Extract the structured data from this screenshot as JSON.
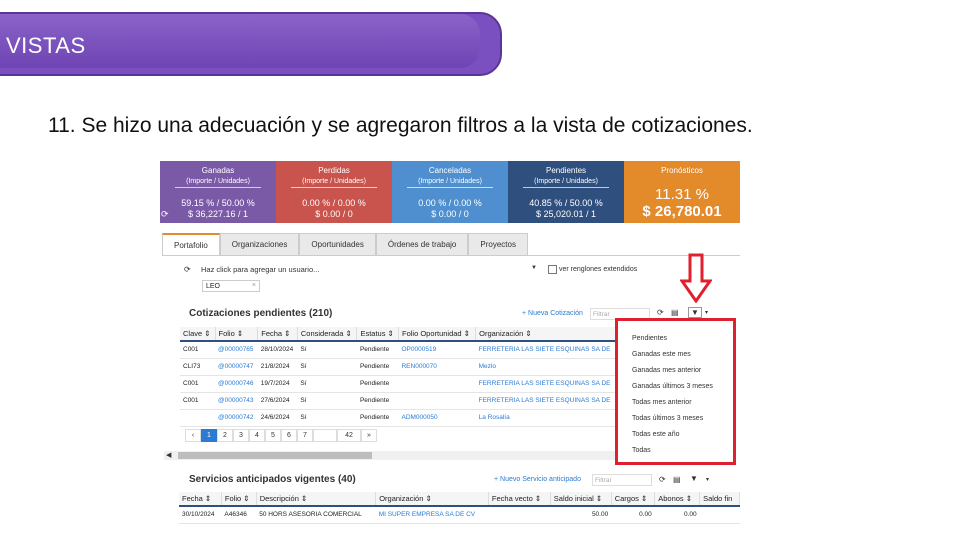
{
  "slide": {
    "title": "VISTAS",
    "text": "11. Se hizo una adecuación y se agregaron filtros a la vista de cotizaciones."
  },
  "colors": {
    "accent": "#7a4fbf",
    "highlight": "#e0202e",
    "link": "#2b7bd3"
  },
  "kpis": [
    {
      "title": "Ganadas",
      "sub": "(Importe / Unidades)",
      "v1": "59.15 % / 50.00 %",
      "v2": "$ 36,227.16 / 1"
    },
    {
      "title": "Perdidas",
      "sub": "(Importe / Unidades)",
      "v1": "0.00 % / 0.00 %",
      "v2": "$ 0.00 / 0"
    },
    {
      "title": "Canceladas",
      "sub": "(Importe / Unidades)",
      "v1": "0.00 % / 0.00 %",
      "v2": "$ 0.00 / 0"
    },
    {
      "title": "Pendientes",
      "sub": "(Importe / Unidades)",
      "v1": "40.85 % / 50.00 %",
      "v2": "$ 25,020.01 / 1"
    },
    {
      "title": "Pronósticos",
      "v1": "11.31 %",
      "v2": "$ 26,780.01"
    }
  ],
  "tabs": [
    "Portafolio",
    "Organizaciones",
    "Oportunidades",
    "Órdenes de trabajo",
    "Proyectos"
  ],
  "userbar": {
    "placeholder": "Haz click para agregar un usuario...",
    "chip": "LEO",
    "extended_label": "ver renglones extendidos"
  },
  "quotes": {
    "title": "Cotizaciones pendientes (210)",
    "new_label": "+ Nueva Cotización",
    "filter_placeholder": "Filtrar",
    "columns": [
      "Clave ⇕",
      "Folio ⇕",
      "Fecha ⇕",
      "Considerada ⇕",
      "Estatus ⇕",
      "Folio Oportunidad ⇕",
      "Organización ⇕"
    ],
    "rows": [
      {
        "clave": "C001",
        "folio": "@00000765",
        "fecha": "28/10/2024",
        "considerada": "Sí",
        "estatus": "Pendiente",
        "oportunidad": "OP0000519",
        "organizacion": "FERRETERIA LAS SIETE ESQUINAS SA DE"
      },
      {
        "clave": "CLI73",
        "folio": "@00000747",
        "fecha": "21/8/2024",
        "considerada": "Sí",
        "estatus": "Pendiente",
        "oportunidad": "REN000070",
        "organizacion": "Mezlo"
      },
      {
        "clave": "C001",
        "folio": "@00000746",
        "fecha": "19/7/2024",
        "considerada": "Sí",
        "estatus": "Pendiente",
        "oportunidad": "",
        "organizacion": "FERRETERIA LAS SIETE ESQUINAS SA DE"
      },
      {
        "clave": "C001",
        "folio": "@00000743",
        "fecha": "27/6/2024",
        "considerada": "Sí",
        "estatus": "Pendiente",
        "oportunidad": "",
        "organizacion": "FERRETERIA LAS SIETE ESQUINAS SA DE"
      },
      {
        "clave": "",
        "folio": "@00000742",
        "fecha": "24/6/2024",
        "considerada": "Sí",
        "estatus": "Pendiente",
        "oportunidad": "ADM000050",
        "organizacion": "La Rosalía"
      }
    ],
    "pages": [
      "‹",
      "1",
      "2",
      "3",
      "4",
      "5",
      "6",
      "7",
      "",
      "42",
      "»"
    ]
  },
  "filter_menu": [
    "Pendientes",
    "Ganadas este mes",
    "Ganadas mes anterior",
    "Ganadas últimos 3 meses",
    "Todas mes anterior",
    "Todas últimos 3 meses",
    "Todas este año",
    "Todas"
  ],
  "services": {
    "title": "Servicios anticipados vigentes (40)",
    "new_label": "+ Nuevo Servicio anticipado",
    "filter_placeholder": "Filtrar",
    "columns": [
      "Fecha ⇕",
      "Folio ⇕",
      "Descripción ⇕",
      "Organización ⇕",
      "Fecha vecto ⇕",
      "Saldo inicial ⇕",
      "Cargos ⇕",
      "Abonos ⇕",
      "Saldo fin"
    ],
    "rows": [
      {
        "fecha": "30/10/2024",
        "folio": "A46346",
        "descripcion": "50 HORS ASESORIA COMERCIAL",
        "organizacion": "MI SUPER EMPRESA SA DE CV",
        "vecto": "",
        "saldo": "50.00",
        "cargos": "0.00",
        "abonos": "0.00",
        "fin": ""
      }
    ]
  }
}
